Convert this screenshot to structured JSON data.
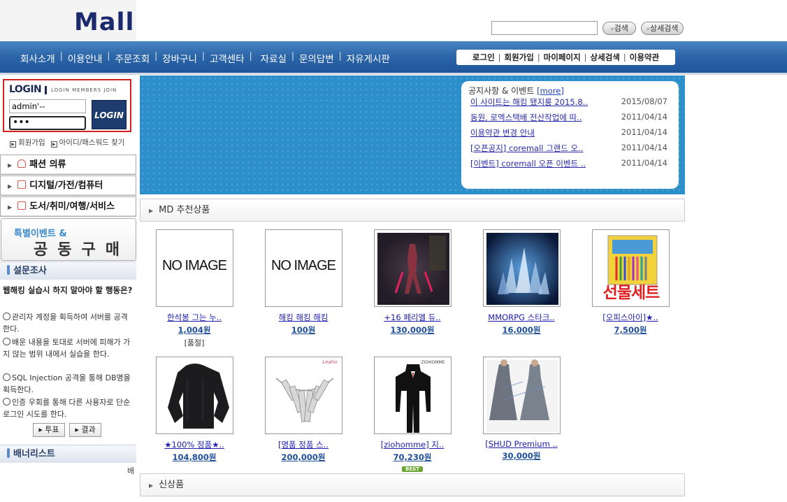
{
  "header": {
    "logo": "Mall",
    "search": {
      "value": "",
      "placeholder": ""
    },
    "search_button": "검색",
    "detail_search_button": "상세검색"
  },
  "nav": {
    "main": [
      "회사소개",
      "이용안내",
      "주문조회",
      "장바구니",
      "고객센타",
      "자료실",
      "문의답변",
      "자유게시판"
    ],
    "user": [
      "로그인",
      "회원가입",
      "마이페이지",
      "상세검색",
      "이용약관"
    ]
  },
  "login": {
    "title": "LOGIN",
    "subtitle": "LOGIN MEMBERS JOIN",
    "id_value": "admin'--",
    "pw_value": "•••",
    "button": "LOGIN",
    "links": [
      "회원가입",
      "아이디/패스워드 찾기"
    ]
  },
  "categories": [
    "패션 의류",
    "디지털/가전/컴퓨터",
    "도서/취미/여행/서비스"
  ],
  "event": {
    "line1": "특별이벤트 &",
    "line2": "공동구매"
  },
  "poll": {
    "header": "설문조사",
    "question": "웹해킹 실습시 하지 말아야 할 행동은?",
    "options": [
      "관리자 계정을 획득하여 서버를 공격한다.",
      "배운 내용을 토대로 서버에 피해가 가지 않는 범위 내에서 실습을 한다.",
      "SQL Injection 공격을 통해 DB명을 획득한다.",
      "인증 우회를 통해 다른 사용자로 단순 로그인 시도를 한다."
    ],
    "vote_button": "투표",
    "result_button": "결과"
  },
  "banner_list": {
    "header": "배너리스트",
    "text": "배"
  },
  "notice": {
    "title": "공지사항 & 이벤트",
    "more": "[more]",
    "items": [
      {
        "title": "이 사이트는 해킹 됐지롱 2015.8..",
        "date": "2015/08/07"
      },
      {
        "title": "동원, 로엑스택배 전산작업에 따..",
        "date": "2011/04/14"
      },
      {
        "title": "이용약관 변경 안내",
        "date": "2011/04/14"
      },
      {
        "title": "[오픈공지] coremall 그랜드 오..",
        "date": "2011/04/14"
      },
      {
        "title": "[이벤트] coremall 오픈 이벤트 ..",
        "date": "2011/04/14"
      }
    ]
  },
  "md_section": {
    "title": "MD 추천상품"
  },
  "new_section": {
    "title": "신상품"
  },
  "products": [
    {
      "name": "한석봉 그는 누..",
      "price": "1,004원",
      "note": "[품절]",
      "image": "NO IMAGE",
      "badge": ""
    },
    {
      "name": "해킹 해킹 해킹",
      "price": "100원",
      "note": "",
      "image": "NO IMAGE",
      "badge": ""
    },
    {
      "name": "+16 페리엘 듀..",
      "price": "130,000원",
      "note": "",
      "image": "game-character",
      "badge": ""
    },
    {
      "name": "MMORPG 스타크..",
      "price": "16,000원",
      "note": "",
      "image": "crystals",
      "badge": ""
    },
    {
      "name": "[오피스아이]★..",
      "price": "7,500원",
      "note": "",
      "image": "gift-set",
      "badge": ""
    },
    {
      "name": "★100% 정품★..",
      "price": "104,800원",
      "note": "",
      "image": "black-shirt",
      "badge": ""
    },
    {
      "name": "[명품 정품 스..",
      "price": "200,000원",
      "note": "",
      "image": "necklace",
      "badge": ""
    },
    {
      "name": "[ziohomme] 지..",
      "price": "70,230원",
      "note": "",
      "image": "suit",
      "badge": "BEST"
    },
    {
      "name": "[SHUD Premium ..",
      "price": "30,000원",
      "note": "",
      "image": "dress",
      "badge": ""
    }
  ],
  "product_image_texts": {
    "gift": "선물세트",
    "suit_brand": "ZIOHOMME",
    "necklace_brand": "Leaho"
  },
  "colors": {
    "nav_blue": "#2d67aa",
    "banner_blue": "#2c8fca",
    "login_red": "#d42020",
    "link_blue": "#2020b0",
    "price_blue": "#1f4f99"
  }
}
